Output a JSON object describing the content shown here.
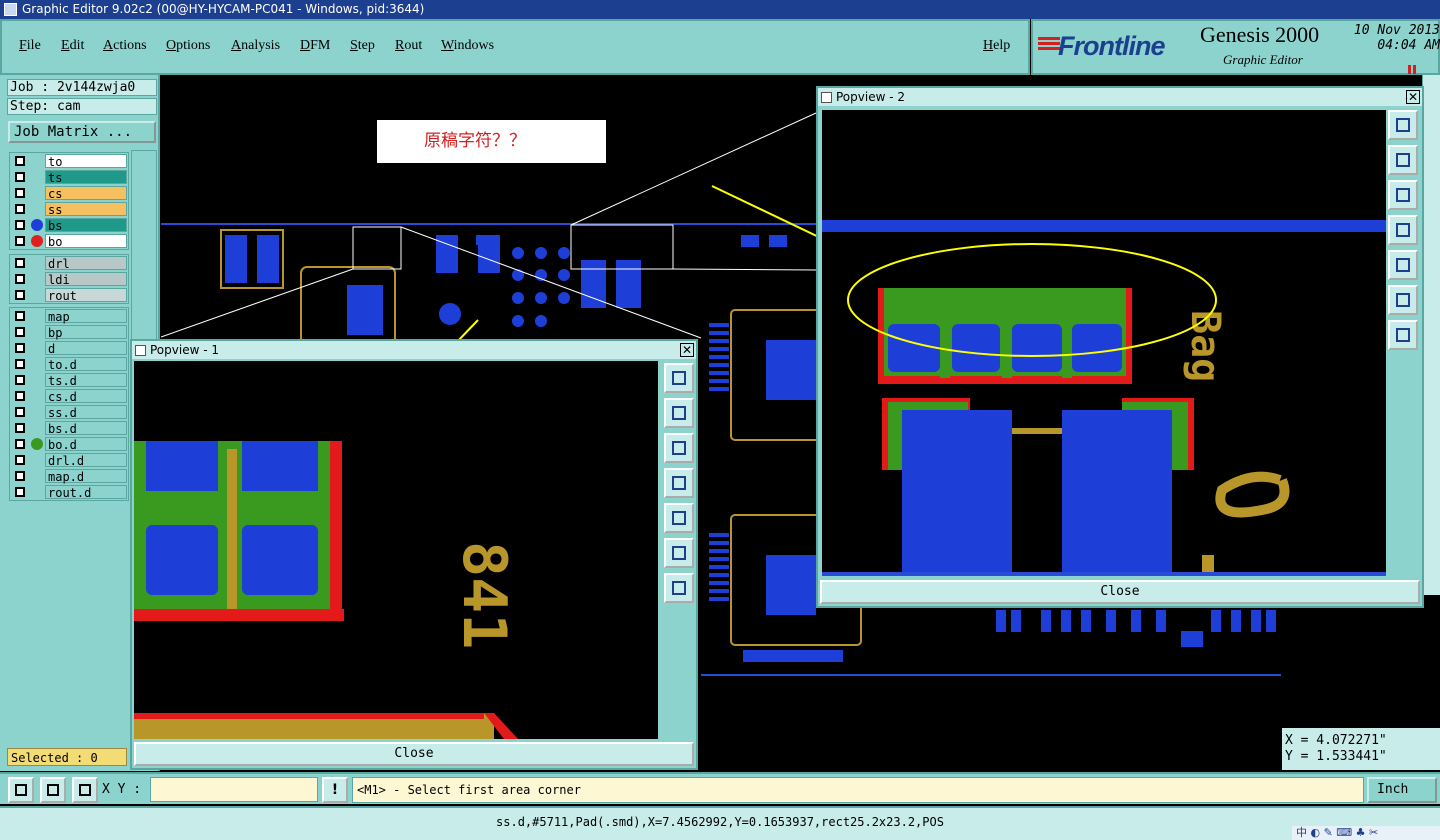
{
  "window": {
    "title": "Graphic Editor 9.02c2 (00@HY-HYCAM-PC041 - Windows, pid:3644)"
  },
  "menu": {
    "items": [
      "File",
      "Edit",
      "Actions",
      "Options",
      "Analysis",
      "DFM",
      "Step",
      "Rout",
      "Windows"
    ],
    "help": "Help"
  },
  "brand": {
    "logo": "Frontline",
    "product": "Genesis 2000",
    "subtitle": "Graphic Editor",
    "date": "10 Nov 2013",
    "time": "04:04 AM"
  },
  "job": {
    "job_label": "Job : 2v144zwja0",
    "step_label": "Step: cam",
    "matrix_button": "Job Matrix ..."
  },
  "layers": {
    "group1": [
      {
        "name": "to",
        "color": "#ffffff",
        "dot": ""
      },
      {
        "name": "ts",
        "color": "#1f9a8a",
        "dot": ""
      },
      {
        "name": "cs",
        "color": "#f6c060",
        "dot": ""
      },
      {
        "name": "ss",
        "color": "#f6c060",
        "dot": ""
      },
      {
        "name": "bs",
        "color": "#1f9a8a",
        "dot": "#1d3fd8"
      },
      {
        "name": "bo",
        "color": "#ffffff",
        "dot": "#e02020"
      }
    ],
    "group2": [
      {
        "name": "drl",
        "color": "#b8c8c8",
        "dot": ""
      },
      {
        "name": "ldi",
        "color": "#b8c8c8",
        "dot": ""
      },
      {
        "name": "rout",
        "color": "#c8d8d8",
        "dot": ""
      }
    ],
    "group3": [
      {
        "name": "map",
        "color": "#8cd3ce",
        "dot": ""
      },
      {
        "name": "bp",
        "color": "#8cd3ce",
        "dot": ""
      },
      {
        "name": "d",
        "color": "#8cd3ce",
        "dot": ""
      },
      {
        "name": "to.d",
        "color": "#8cd3ce",
        "dot": ""
      },
      {
        "name": "ts.d",
        "color": "#8cd3ce",
        "dot": ""
      },
      {
        "name": "cs.d",
        "color": "#8cd3ce",
        "dot": ""
      },
      {
        "name": "ss.d",
        "color": "#8cd3ce",
        "dot": ""
      },
      {
        "name": "bs.d",
        "color": "#8cd3ce",
        "dot": ""
      },
      {
        "name": "bo.d",
        "color": "#8cd3ce",
        "dot": "#3a9a20"
      },
      {
        "name": "drl.d",
        "color": "#8cd3ce",
        "dot": ""
      },
      {
        "name": "map.d",
        "color": "#8cd3ce",
        "dot": ""
      },
      {
        "name": "rout.d",
        "color": "#8cd3ce",
        "dot": ""
      }
    ]
  },
  "selected": "Selected : 0",
  "note": "原稿字符？？",
  "popview1": {
    "title": "Popview - 1",
    "close": "Close",
    "silk_text": "841"
  },
  "popview2": {
    "title": "Popview - 2",
    "close": "Close",
    "silk_text": "Bag"
  },
  "bottom": {
    "xy_label": "X Y :",
    "xy_value": "",
    "prompt": "<M1> - Select first area corner",
    "units": "Inch"
  },
  "coords": {
    "x": "X = 4.072271\"",
    "y": "Y = 1.533441\""
  },
  "status": "ss.d,#5711,Pad(.smd),X=7.4562992,Y=0.1653937,rect25.2x23.2,POS",
  "tray": "中 ◐ ✎ ⌨ ♣ ✂"
}
